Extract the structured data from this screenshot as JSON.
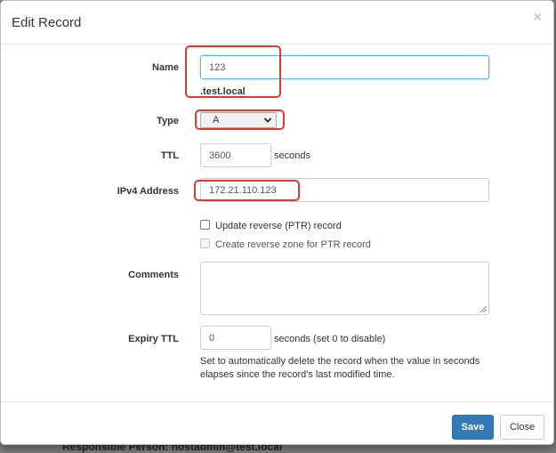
{
  "background": {
    "partial_text": "Responsible Person: hostadmin@test.local"
  },
  "modal": {
    "title": "Edit Record",
    "close_glyph": "×",
    "fields": {
      "name": {
        "label": "Name",
        "value": "123",
        "domain_suffix": ".test.local"
      },
      "type": {
        "label": "Type",
        "selected": "A"
      },
      "ttl": {
        "label": "TTL",
        "value": "3600",
        "unit": "seconds"
      },
      "ipv4": {
        "label": "IPv4 Address",
        "value": "172.21.110.123"
      },
      "update_ptr": {
        "label": "Update reverse (PTR) record",
        "checked": false
      },
      "create_reverse_zone": {
        "label": "Create reverse zone for PTR record",
        "checked": false,
        "disabled": true
      },
      "comments": {
        "label": "Comments",
        "value": ""
      },
      "expiry_ttl": {
        "label": "Expiry TTL",
        "value": "0",
        "unit": "seconds (set 0 to disable)",
        "help": "Set to automatically delete the record when the value in seconds elapses since the record's last modified time."
      }
    },
    "footer": {
      "save_label": "Save",
      "close_label": "Close"
    }
  },
  "colors": {
    "primary": "#337ab7",
    "annotation": "#e0392c",
    "focus": "#66afe9"
  },
  "icons": [
    "close-icon",
    "chevron-down-icon",
    "resize-grip-icon"
  ]
}
